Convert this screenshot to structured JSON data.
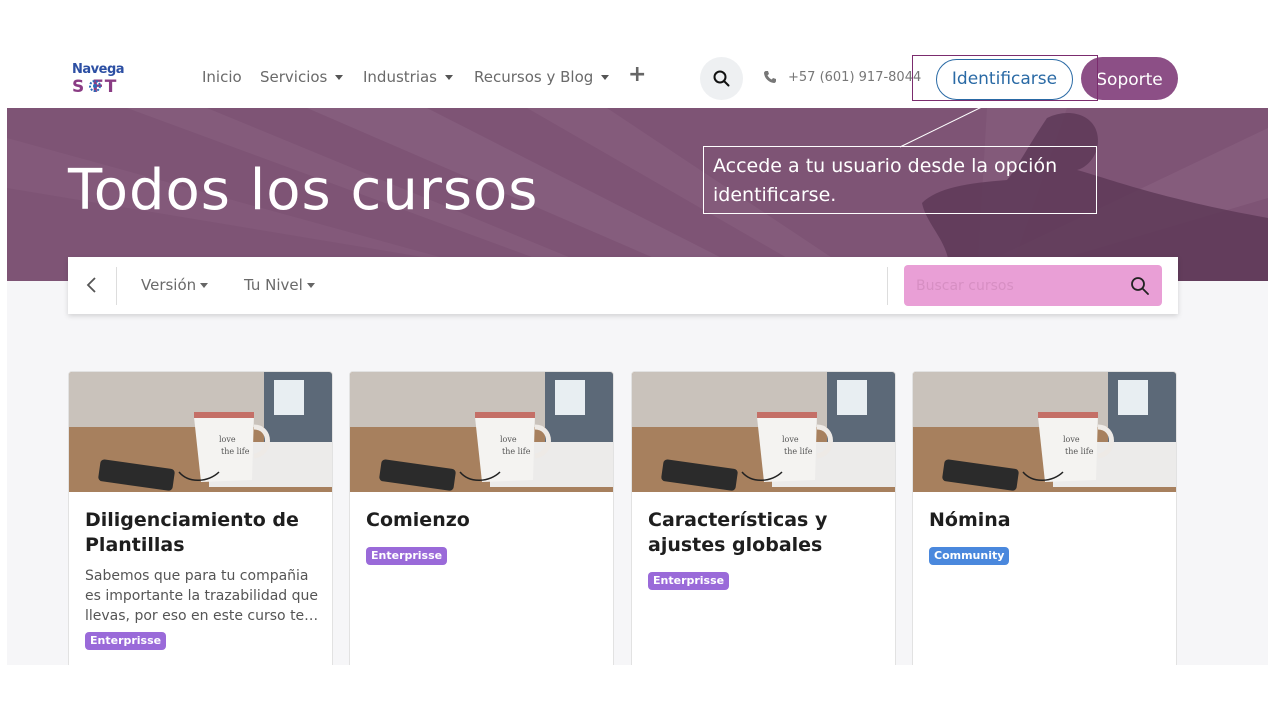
{
  "brand": {
    "line1": "Navega",
    "line2": "S FT"
  },
  "nav": {
    "items": [
      {
        "label": "Inicio",
        "dropdown": false
      },
      {
        "label": "Servicios",
        "dropdown": true
      },
      {
        "label": "Industrias",
        "dropdown": true
      },
      {
        "label": "Recursos y Blog",
        "dropdown": true
      }
    ],
    "plus": "+",
    "phone": "+57 (601) 917-8044",
    "login_label": "Identificarse",
    "support_label": "Soporte"
  },
  "hero": {
    "title": "Todos los cursos"
  },
  "callout": {
    "text": "Accede a tu usuario desde la opción identificarse."
  },
  "filters": {
    "version_label": "Versión",
    "level_label": "Tu Nivel",
    "search_placeholder": "Buscar cursos"
  },
  "courses": [
    {
      "title": "Diligenciamiento de Plantillas",
      "description": "Sabemos que para tu compañia es importante la trazabilidad que llevas, por eso en este curso te…",
      "badge": "Enterprisse"
    },
    {
      "title": "Comienzo",
      "description": "",
      "badge": "Enterprisse"
    },
    {
      "title": "Características y ajustes globales",
      "description": "",
      "badge": "Enterprisse"
    },
    {
      "title": "Nómina",
      "description": "",
      "badge": "Community"
    }
  ],
  "colors": {
    "hero_bg": "#7e5475",
    "support_btn": "#8c4f86",
    "login_border": "#2a6aa5",
    "search_bg": "#e99fd6",
    "badge_enterprise": "#9a6ad9",
    "badge_community": "#4a88dd"
  },
  "icons": [
    "search-icon",
    "phone-icon",
    "plus-icon",
    "chevron-left-icon",
    "chevron-down-icon",
    "magnifier-icon"
  ]
}
